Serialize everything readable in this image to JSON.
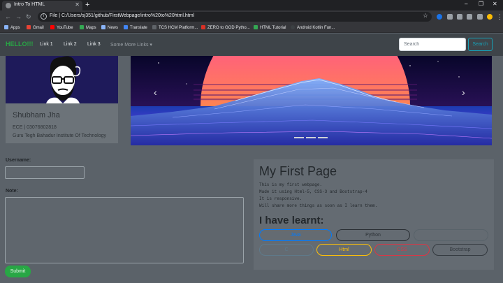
{
  "browser": {
    "tab_title": "Intro To HTML",
    "url": "File  |  C:/Users/sj351/github/FirstWebpage/intro%20to%20html.html",
    "bookmarks": [
      "Apps",
      "Gmail",
      "YouTube",
      "Maps",
      "News",
      "Translate",
      "TCS HCM Platform...",
      "ZERO to GOD Pytho...",
      "HTML Tutorial",
      "Android Kotlin Fun..."
    ]
  },
  "navbar": {
    "brand": "HELLO!!!",
    "links": [
      "Link 1",
      "Link 2",
      "Link 3",
      "Some More Links"
    ],
    "search_placeholder": "Search",
    "search_button": "Search"
  },
  "profile": {
    "name": "Shubham Jha",
    "line1": "ECE | 03076802818",
    "line2": "Guru Tegh Bahadur Institute Of Technology"
  },
  "carousel": {
    "slide_count": 3,
    "active_index": 0
  },
  "form": {
    "username_label": "Username:",
    "note_label": "Note:",
    "submit": "Submit"
  },
  "info": {
    "title": "My First Page",
    "lines": [
      "This is my first webpage.",
      "Made it using Html-5, CSS-3 and Bootstrap-4",
      "It is responsive.",
      "Will share more things as soon as I learn them."
    ],
    "learnt_title": "I have learnt:",
    "skills": [
      "Java",
      "Python",
      "",
      "C",
      "Html",
      "CSS",
      "Bootstrap"
    ]
  },
  "colors": {
    "brand": "#28a745",
    "search": "#17a2b8",
    "skill_java": "#007bff",
    "skill_python": "#2b3035",
    "skill_html": "#ffc107",
    "skill_css": "#dc3545",
    "skill_bootstrap": "#343a40"
  }
}
